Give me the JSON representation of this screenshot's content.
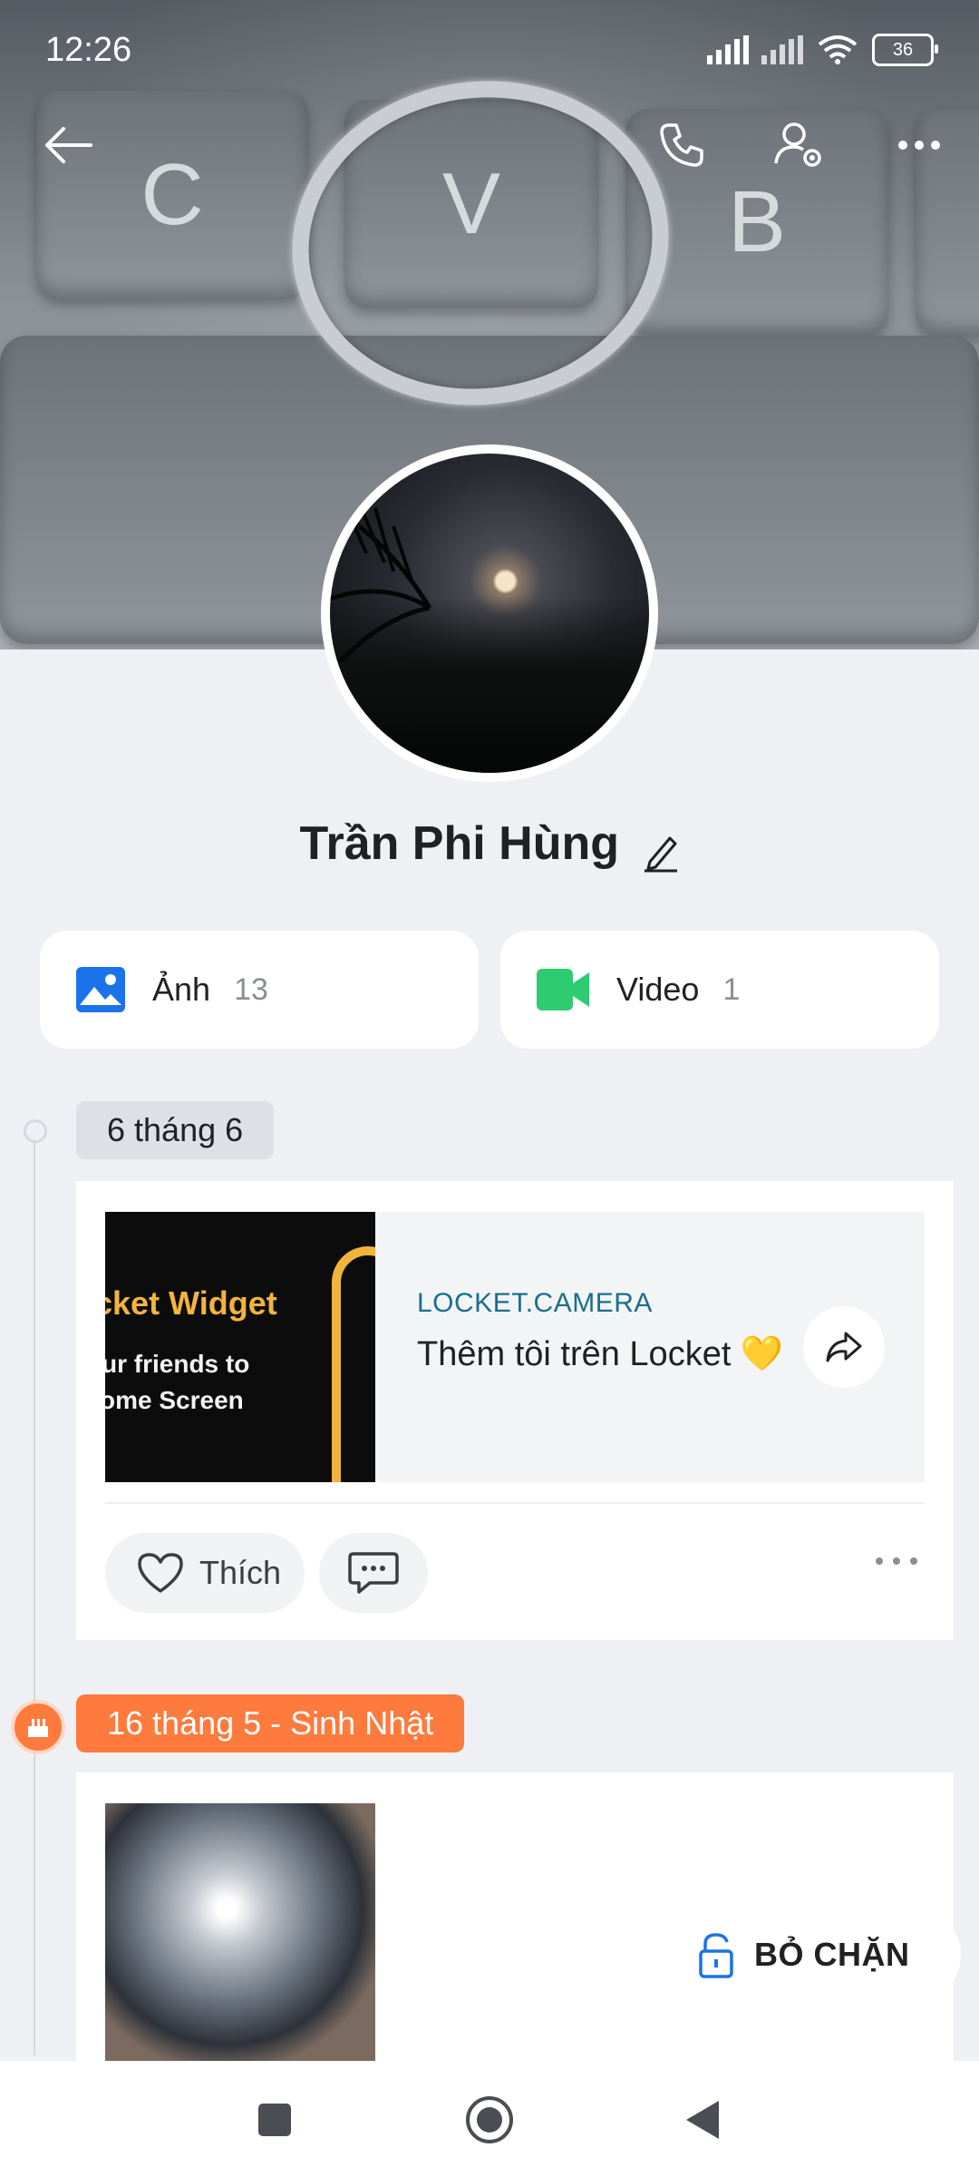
{
  "status_bar": {
    "time": "12:26",
    "battery": "36"
  },
  "profile": {
    "name": "Trần Phi Hùng"
  },
  "media": [
    {
      "label": "Ảnh",
      "count": "13",
      "icon": "image-icon",
      "color": "#1a73e8"
    },
    {
      "label": "Video",
      "count": "1",
      "icon": "video-icon",
      "color": "#2ecc71"
    }
  ],
  "timeline": [
    {
      "date": "6 tháng 6",
      "link": {
        "thumb_line1": "cket Widget",
        "thumb_line2": "ur friends to",
        "thumb_line3": "ome Screen",
        "domain": "LOCKET.CAMERA",
        "title": "Thêm tôi trên Locket 💛"
      },
      "like_label": "Thích"
    },
    {
      "date": "16 tháng 5 - Sinh Nhật"
    }
  ],
  "unblock_label": "BỎ CHẶN",
  "colors": {
    "accent_orange": "#ff7a3d",
    "link_domain": "#1a6f8a"
  }
}
